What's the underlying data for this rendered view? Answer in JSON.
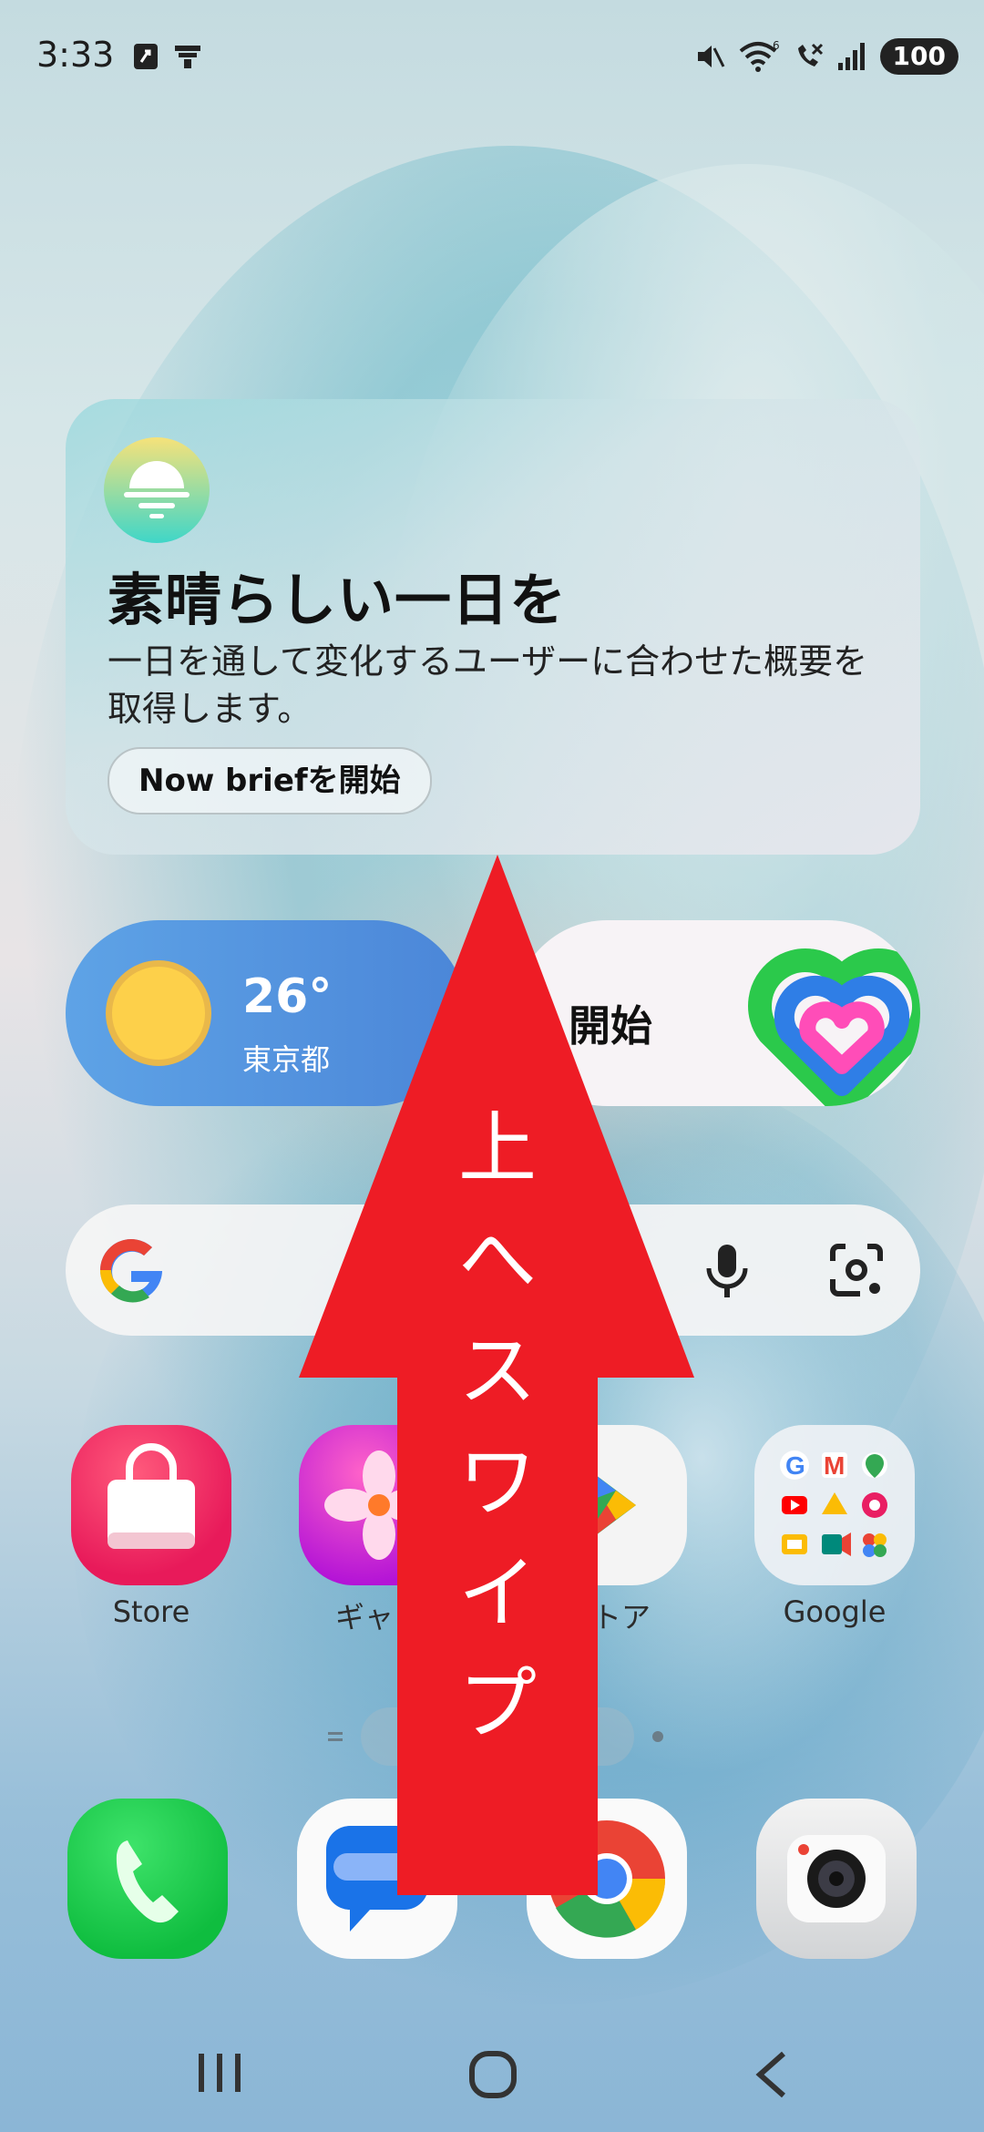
{
  "status_bar": {
    "time": "3:33",
    "battery": "100",
    "wifi_label": "6"
  },
  "brief_card": {
    "title": "素晴らしい一日を",
    "description": "一日を通して変化するユーザーに合わせた概要を取得します。",
    "button_label": "Now briefを開始"
  },
  "weather": {
    "temperature": "26°",
    "city": "東京都"
  },
  "health": {
    "label": "開始"
  },
  "apps": [
    {
      "label": "Store",
      "icon": "store-bag-icon"
    },
    {
      "label": "ギャラ",
      "icon": "gallery-flower-icon"
    },
    {
      "label": "ストア",
      "icon": "play-store-icon"
    },
    {
      "label": "Google",
      "icon": "google-folder-icon"
    }
  ],
  "dock": [
    {
      "icon": "phone-icon"
    },
    {
      "icon": "messages-icon"
    },
    {
      "icon": "chrome-icon"
    },
    {
      "icon": "camera-icon"
    }
  ],
  "overlay": {
    "chars": [
      "上",
      "へ",
      "ス",
      "ワ",
      "イ",
      "プ"
    ],
    "color": "#ee1c25"
  },
  "colors": {
    "weather_bg": "#4b86d8",
    "sun": "#fdd04a"
  }
}
